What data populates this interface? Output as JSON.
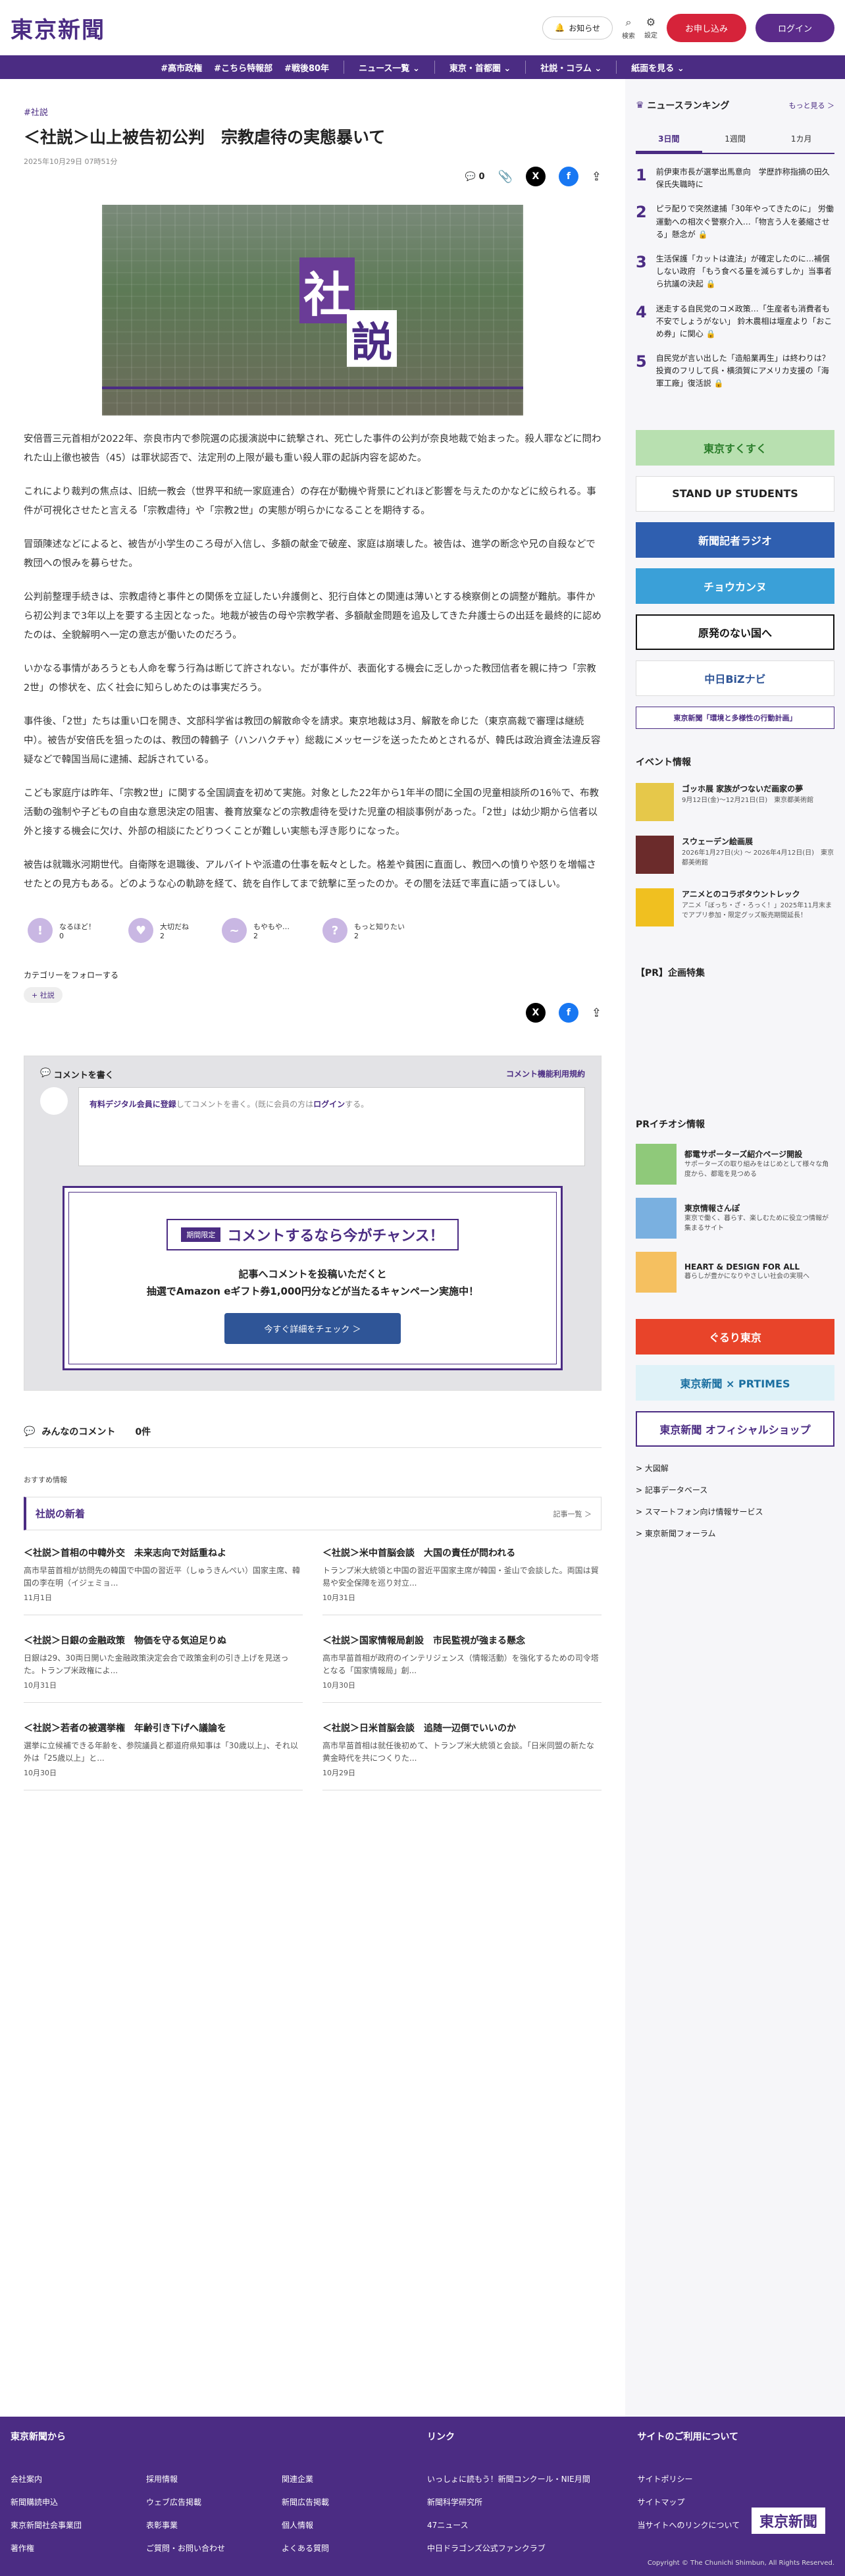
{
  "header": {
    "logo": "東京新聞",
    "notify": "お知らせ",
    "search": "検索",
    "settings": "設定",
    "apply": "お申し込み",
    "login": "ログイン"
  },
  "nav": {
    "items": [
      "#高市政権",
      "#こちら特報部",
      "#戦後80年"
    ],
    "menus": [
      "ニュース一覧 ⌄",
      "東京・首都圏 ⌄",
      "社説・コラム ⌄",
      "紙面を見る ⌄"
    ]
  },
  "article": {
    "tag": "#社説",
    "title": "＜社説＞山上被告初公判　宗教虐待の実態暴いて",
    "date": "2025年10月29日 07時51分",
    "comment_count": "0",
    "stamp1": "社",
    "stamp2": "説",
    "paragraphs": [
      "安倍晋三元首相が2022年、奈良市内で参院選の応援演説中に銃撃され、死亡した事件の公判が奈良地裁で始まった。殺人罪などに問われた山上徹也被告（45）は罪状認否で、法定刑の上限が最も重い殺人罪の起訴内容を認めた。",
      "これにより裁判の焦点は、旧統一教会（世界平和統一家庭連合）の存在が動機や背景にどれほど影響を与えたのかなどに絞られる。事件が可視化させたと言える「宗教虐待」や「宗教2世」の実態が明らかになることを期待する。",
      "冒頭陳述などによると、被告が小学生のころ母が入信し、多額の献金で破産、家庭は崩壊した。被告は、進学の断念や兄の自殺などで教団への恨みを募らせた。",
      "公判前整理手続きは、宗教虐待と事件との関係を立証したい弁護側と、犯行自体との関連は薄いとする検察側との調整が難航。事件から初公判まで3年以上を要する主因となった。地裁が被告の母や宗教学者、多額献金問題を追及してきた弁護士らの出廷を最終的に認めたのは、全貌解明へ一定の意志が働いたのだろう。",
      "いかなる事情があろうとも人命を奪う行為は断じて許されない。だが事件が、表面化する機会に乏しかった教団信者を親に持つ「宗教2世」の惨状を、広く社会に知らしめたのは事実だろう。",
      "事件後、「2世」たちは重い口を開き、文部科学省は教団の解散命令を請求。東京地裁は3月、解散を命じた（東京高裁で審理は継続中）。被告が安倍氏を狙ったのは、教団の韓鶴子（ハンハクチャ）総裁にメッセージを送ったためとされるが、韓氏は政治資金法違反容疑などで韓国当局に逮捕、起訴されている。",
      "こども家庭庁は昨年、「宗教2世」に関する全国調査を初めて実施。対象とした22年から1年半の間に全国の児童相談所の16％で、布教活動の強制や子どもの自由な意思決定の阻害、養育放棄などの宗教虐待を受けた児童の相談事例があった。「2世」は幼少期から信者以外と接する機会に欠け、外部の相談にたどりつくことが難しい実態も浮き彫りになった。",
      "被告は就職氷河期世代。自衛隊を退職後、アルバイトや派遣の仕事を転々とした。格差や貧困に直面し、教団への憤りや怒りを増幅させたとの見方もある。どのような心の軌跡を経て、銃を自作してまで銃撃に至ったのか。その闇を法廷で率直に語ってほしい。"
    ]
  },
  "reactions": [
    {
      "icon": "!",
      "label": "なるほど！",
      "count": "0"
    },
    {
      "icon": "♥",
      "label": "大切だね",
      "count": "2"
    },
    {
      "icon": "~",
      "label": "もやもや…",
      "count": "2"
    },
    {
      "icon": "?",
      "label": "もっと知りたい",
      "count": "2"
    }
  ],
  "follow": {
    "label": "カテゴリーをフォローする",
    "chip": "+ 社説"
  },
  "comment": {
    "title": "コメントを書く",
    "policy": "コメント機能利用規約",
    "placeholder_pre": "有料デジタル会員に登録",
    "placeholder_mid": "してコメントを書く。(既に会員の方は",
    "placeholder_login": "ログイン",
    "placeholder_post": "する。",
    "promo_limited": "期間限定",
    "promo_title": "コメントするなら今がチャンス！",
    "promo_line1": "記事へコメントを投稿いただくと",
    "promo_line2": "抽選でAmazon eギフト券1,000円分などが当たるキャンペーン実施中！",
    "promo_cta": "今すぐ詳細をチェック ＞",
    "all_comments": "みんなのコメント",
    "all_count": "0件"
  },
  "recommend": {
    "label": "おすすめ情報",
    "section": "社説の新着",
    "more": "記事一覧 ＞",
    "items": [
      {
        "title": "＜社説＞首相の中韓外交　未来志向で対話重ねよ",
        "desc": "高市早苗首相が訪問先の韓国で中国の習近平（しゅうきんぺい）国家主席、韓国の李在明（イジェミョ...",
        "date": "11月1日"
      },
      {
        "title": "＜社説＞米中首脳会談　大国の責任が問われる",
        "desc": "トランプ米大統領と中国の習近平国家主席が韓国・釜山で会談した。両国は貿易や安全保障を巡り対立...",
        "date": "10月31日"
      },
      {
        "title": "＜社説＞日銀の金融政策　物価を守る気迫足りぬ",
        "desc": "日銀は29、30両日開いた金融政策決定会合で政策金利の引き上げを見送った。トランプ米政権によ...",
        "date": "10月31日"
      },
      {
        "title": "＜社説＞国家情報局創設　市民監視が強まる懸念",
        "desc": "高市早苗首相が政府のインテリジェンス（情報活動）を強化するための司令塔となる「国家情報局」創...",
        "date": "10月30日"
      },
      {
        "title": "＜社説＞若者の被選挙権　年齢引き下げへ議論を",
        "desc": "選挙に立候補できる年齢を、参院議員と都道府県知事は「30歳以上」、それ以外は「25歳以上」と...",
        "date": "10月30日"
      },
      {
        "title": "＜社説＞日米首脳会談　追随一辺倒でいいのか",
        "desc": "高市早苗首相は就任後初めて、トランプ米大統領と会談。「日米同盟の新たな黄金時代を共につくりた...",
        "date": "10月29日"
      }
    ]
  },
  "sidebar": {
    "ranking_title": "ニュースランキング",
    "ranking_more": "もっと見る ＞",
    "tabs": [
      "3日間",
      "1週間",
      "1カ月"
    ],
    "ranking": [
      {
        "n": "1",
        "t": "前伊東市長が選挙出馬意向　学歴詐称指摘の田久保氏失職時に"
      },
      {
        "n": "2",
        "t": "ピラ配りで突然逮捕「30年やってきたのに」 労働運動への相次ぐ警察介入…「物言う人を萎縮させる」懸念が 🔒"
      },
      {
        "n": "3",
        "t": "生活保護「カットは違法」が確定したのに…補償しない政府 「もう食べる量を減らすしか」当事者ら抗議の決起 🔒"
      },
      {
        "n": "4",
        "t": "迷走する自民党のコメ政策…「生産者も消費者も不安でしょうがない」 鈴木農相は堰産より「おこめ券」に関心 🔒"
      },
      {
        "n": "5",
        "t": "自民党が言い出した「造船業再生」は終わりは？ 投資のフリして呉・横須賀にアメリカ支援の「海軍工廠」復活説 🔒"
      }
    ],
    "banners": [
      {
        "text": "東京すくすく",
        "bg": "#b8e0b0",
        "fg": "#2a7d2a"
      },
      {
        "text": "STAND UP STUDENTS",
        "bg": "#ffffff",
        "fg": "#222222"
      },
      {
        "text": "新聞記者ラジオ",
        "bg": "#2f5fb0",
        "fg": "#ffffff"
      },
      {
        "text": "チョウカンヌ",
        "bg": "#3aa0d8",
        "fg": "#ffffff"
      },
      {
        "text": "原発のない国へ",
        "bg": "#ffffff",
        "fg": "#111111"
      },
      {
        "text": "中日BiZナビ",
        "bg": "#ffffff",
        "fg": "#2f5597"
      },
      {
        "text": "東京新聞「環境と多様性の行動計画」",
        "bg": "#ffffff",
        "fg": "#4b2c83"
      }
    ],
    "events_title": "イベント情報",
    "events": [
      {
        "t": "ゴッホ展 家族がつないだ画家の夢",
        "d": "9月12日(金)〜12月21日(日)　東京都美術館",
        "c": "#e6c84a"
      },
      {
        "t": "スウェーデン絵画展",
        "d": "2026年1月27日(火) 〜 2026年4月12日(日)　東京都美術館",
        "c": "#6b2b2b"
      },
      {
        "t": "アニメとのコラボタウントレック",
        "d": "アニメ「ぼっち・ざ・ろっく！」2025年11月末までアプリ参加・限定グッズ販売期間延長！",
        "c": "#f0c020"
      }
    ],
    "pr_title": "【PR】企画特集",
    "pr2_title": "PRイチオシ情報",
    "pr_items": [
      {
        "t": "都電サポーターズ紹介ページ開設",
        "d": "サポーターズの取り組みをはじめとして様々な角度から、都電を見つめる",
        "c": "#8fc97a"
      },
      {
        "t": "東京情報さんぽ",
        "d": "東京で働く、暮らす、楽しむために役立つ情報が集まるサイト",
        "c": "#7ab0e0"
      },
      {
        "t": "HEART & DESIGN FOR ALL",
        "d": "暮らしが豊かになりやさしい社会の実現へ",
        "c": "#f5c060"
      }
    ],
    "banners2": [
      {
        "text": "ぐるり東京",
        "bg": "#e8442a",
        "fg": "#ffffff"
      },
      {
        "text": "東京新聞 × PRTIMES",
        "bg": "#dff2f8",
        "fg": "#1a6fa0"
      },
      {
        "text": "東京新聞 オフィシャルショップ",
        "bg": "#ffffff",
        "fg": "#4b2c83"
      }
    ],
    "links": [
      "> 大図解",
      "> 記事データベース",
      "> スマートフォン向け情報サービス",
      "> 東京新聞フォーラム"
    ]
  },
  "footer": {
    "col1_title": "東京新聞から",
    "col1": [
      "会社案内",
      "採用情報",
      "関連企業",
      "新聞購読申込",
      "ウェブ広告掲載",
      "新聞広告掲載",
      "東京新聞社会事業団",
      "表彰事業",
      "個人情報",
      "著作権",
      "ご質問・お問い合わせ",
      "よくある質問"
    ],
    "col2_title": "リンク",
    "col2": [
      "いっしょに読もう！新聞コンクール・NIE月間",
      "新聞科学研究所",
      "47ニュース",
      "中日ドラゴンズ公式ファンクラブ"
    ],
    "col3_title": "サイトのご利用について",
    "col3": [
      "サイトポリシー",
      "サイトマップ",
      "当サイトへのリンクについて"
    ],
    "logo": "東京新聞",
    "copyright": "Copyright © The Chunichi Shimbun, All Rights Reserved."
  }
}
